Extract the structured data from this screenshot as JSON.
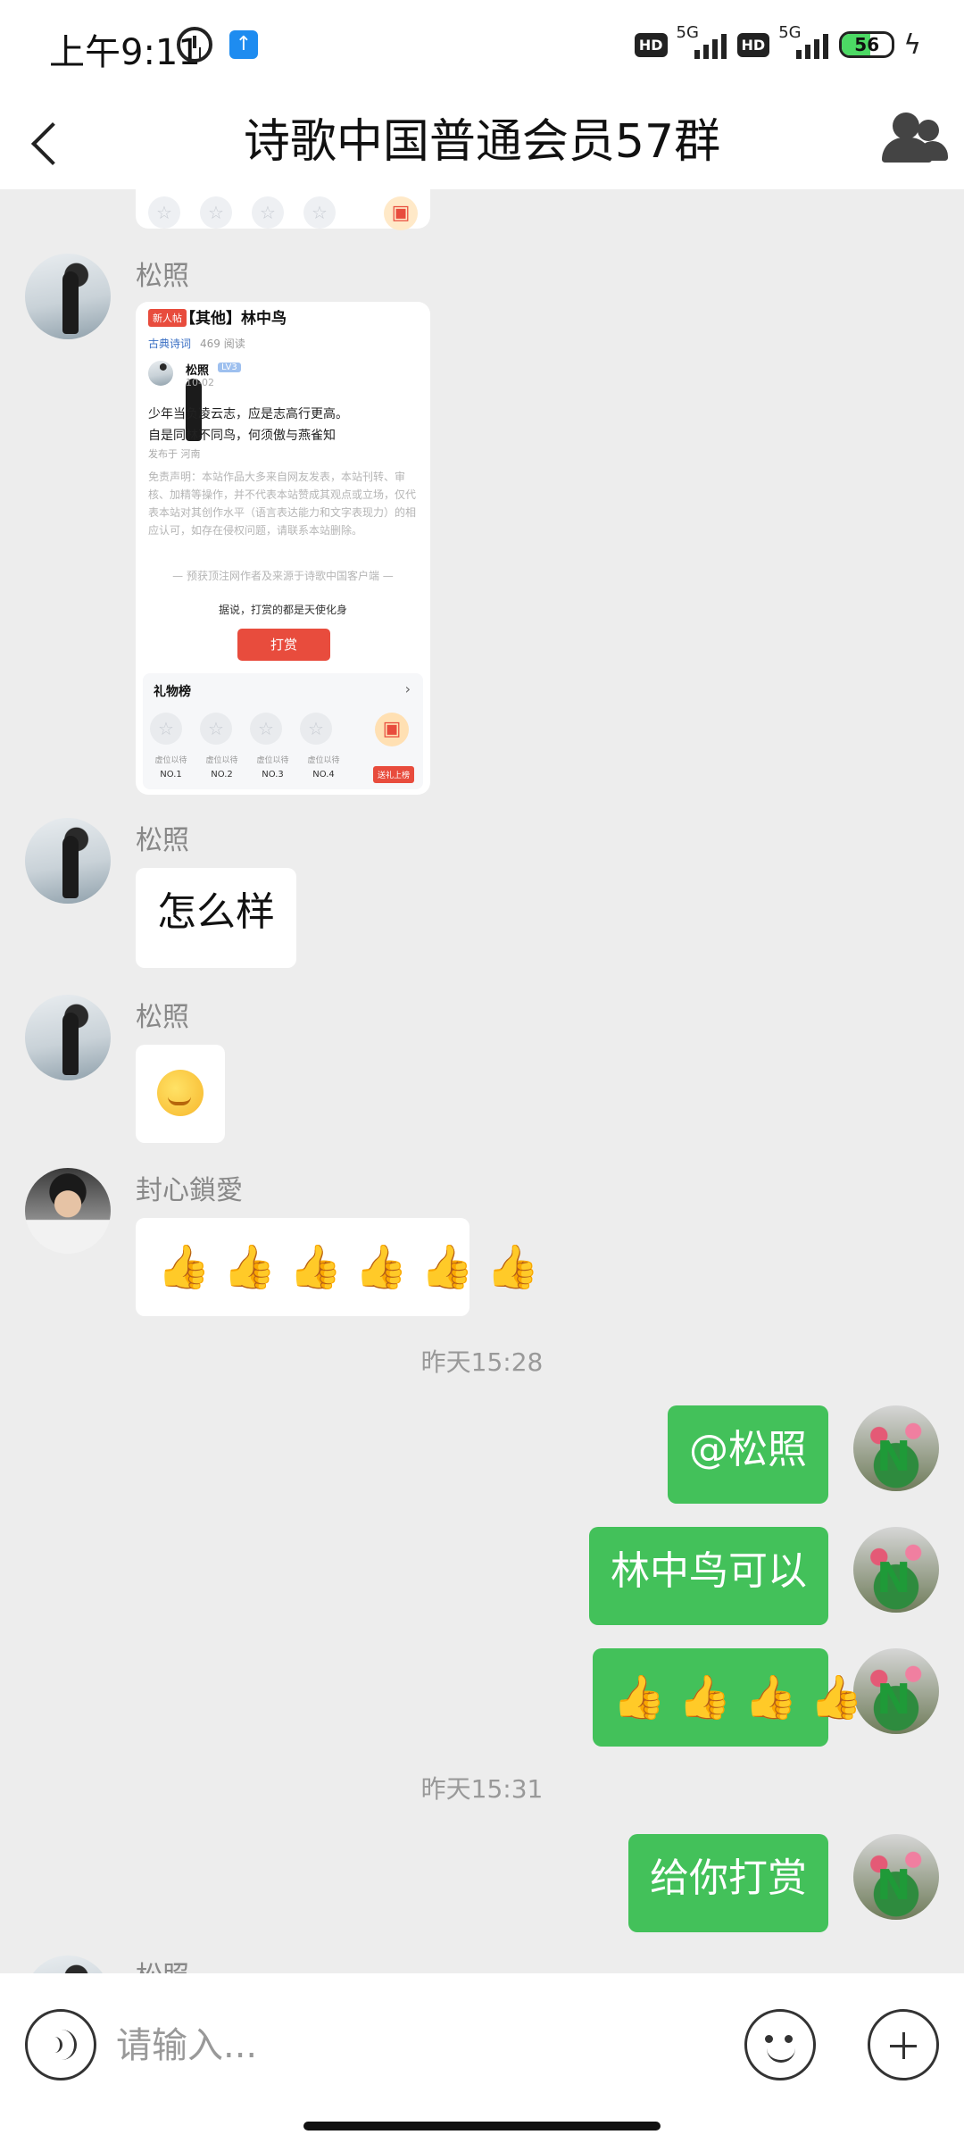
{
  "status": {
    "time": "上午9:11",
    "battery": "56",
    "battery_level": 0.56,
    "network1": "5G",
    "network2": "5G",
    "hd": "HD"
  },
  "nav": {
    "title": "诗歌中国普通会员57群"
  },
  "messages": {
    "m1": {
      "sender": "松照"
    },
    "card": {
      "badge": "新人帖",
      "title": "【其他】林中鸟",
      "category": "古典诗词",
      "reads": "469 阅读",
      "author": "松照",
      "level": "LV3",
      "date": "10-02",
      "poem_line1": "少年当负凌云志，应是志高行更高。",
      "poem_line2": "自是同林不同鸟，何须傲与燕雀知",
      "location": "发布于 河南",
      "disclaimer": "免责声明：本站作品大多来自网友发表，本站刊转、审核、加精等操作，并不代表本站赞成其观点或立场，仅代表本站对其创作水平（语言表达能力和文字表现力）的相应认可，如存在侵权问题，请联系本站删除。",
      "separator": "— 预获顶注网作者及来源于诗歌中国客户端 —",
      "hint": "据说，打赏的都是天使化身",
      "reward_button": "打赏",
      "gift_title": "礼物榜",
      "gift_labels": [
        "虚位以待",
        "虚位以待",
        "虚位以待",
        "虚位以待"
      ],
      "gift_ranks": [
        "NO.1",
        "NO.2",
        "NO.3",
        "NO.4"
      ],
      "gift_button": "送礼上榜"
    },
    "m2": {
      "sender": "松照",
      "text": "怎么样"
    },
    "m3": {
      "sender": "松照"
    },
    "m4": {
      "sender": "封心鎖愛"
    },
    "ts1": "昨天15:28",
    "m5": {
      "text": "@松照"
    },
    "m6": {
      "text": "林中鸟可以"
    },
    "ts2": "昨天15:31",
    "m8": {
      "text": "给你打赏"
    },
    "m9": {
      "sender": "松照"
    }
  },
  "input": {
    "placeholder": "请输入..."
  },
  "colors": {
    "green_bubble": "#43c15a",
    "background": "#ededed",
    "accent_red": "#e84c3d"
  }
}
